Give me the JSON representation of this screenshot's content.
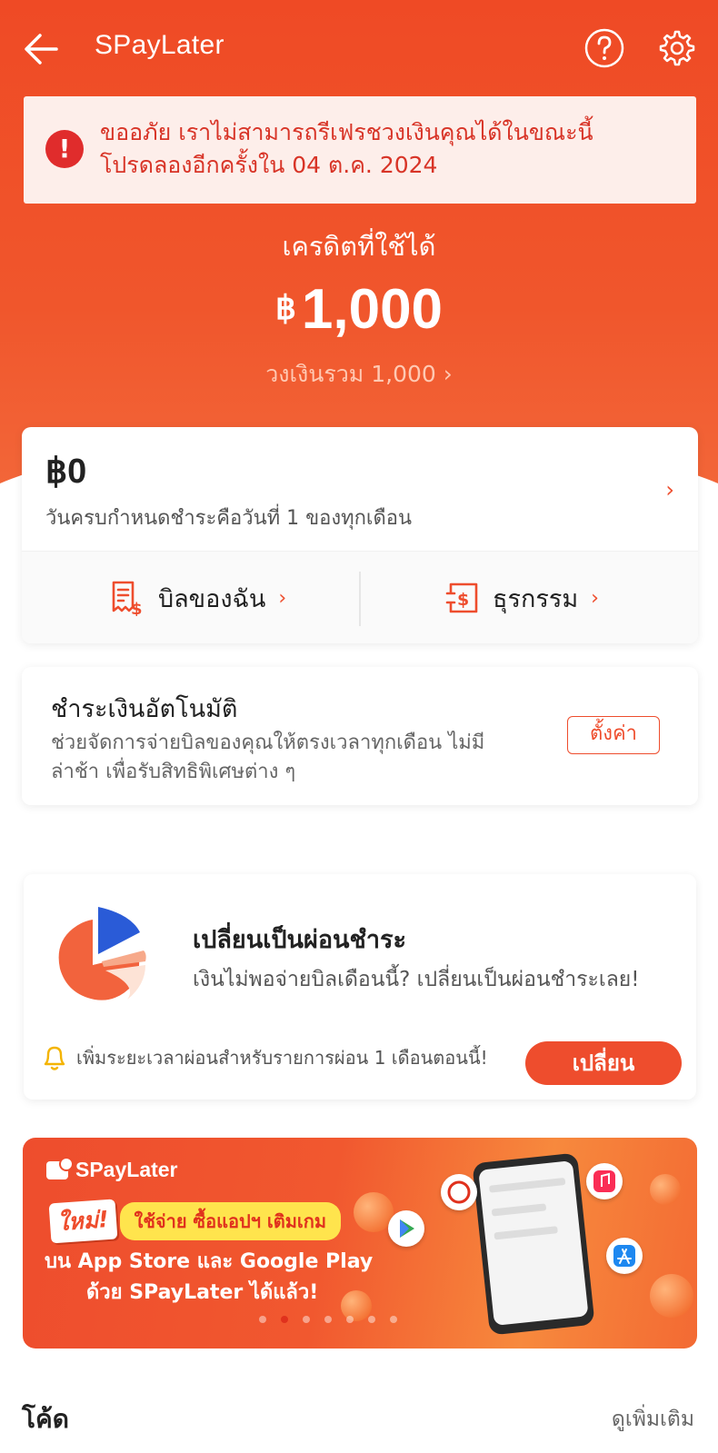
{
  "header": {
    "title": "SPayLater",
    "back_icon": "arrow-left-icon",
    "help_icon": "question-circle-icon",
    "settings_icon": "gear-icon"
  },
  "alert": {
    "icon": "exclamation-circle-icon",
    "line1": "ขออภัย เราไม่สามารถรีเฟรชวงเงินคุณได้ในขณะนี้",
    "line2": "โปรดลองอีกครั้งใน 04 ต.ค. 2024"
  },
  "credit": {
    "label": "เครดิตที่ใช้ได้",
    "currency": "฿",
    "amount": "1,000",
    "total": "วงเงินรวม 1,000 ›"
  },
  "bill": {
    "amount": "฿0",
    "due_text": "วันครบกำหนดชำระคือวันที่ 1 ของทุกเดือน",
    "chevron": "›",
    "my_bills_label": "บิลของฉัน",
    "transactions_label": "ธุรกรรม",
    "chevron_small": "›"
  },
  "auto_pay": {
    "title": "ชำระเงินอัตโนมัติ",
    "desc_line1": "ช่วยจัดการจ่ายบิลของคุณให้ตรงเวลาทุกเดือน ไม่มี",
    "desc_line2": "ล่าช้า เพื่อรับสิทธิพิเศษต่าง ๆ",
    "button": "ตั้งค่า"
  },
  "installment": {
    "title": "เปลี่ยนเป็นผ่อนชำระ",
    "desc": "เงินไม่พอจ่ายบิลเดือนนี้? เปลี่ยนเป็นผ่อนชำระเลย!",
    "note": "เพิ่มระยะเวลาผ่อนสำหรับรายการผ่อน 1 เดือนตอนนี้!",
    "button": "เปลี่ยน"
  },
  "banner": {
    "logo": "SPayLater",
    "new_tag": "ใหม่!",
    "pill": "ใช้จ่าย ซื้อแอปฯ เติมเกม",
    "line1": "บน App Store และ Google Play",
    "line2": "ด้วย SPayLater ได้แล้ว!",
    "slide_count": 7,
    "active_slide": 2
  },
  "codes": {
    "title": "โค้ด",
    "see_more": "ดูเพิ่มเติม"
  },
  "colors": {
    "brand": "#ee4d2d",
    "alert_text": "#d83427",
    "alert_bg": "#fdeeea",
    "banner_pill": "#ffe44d"
  }
}
